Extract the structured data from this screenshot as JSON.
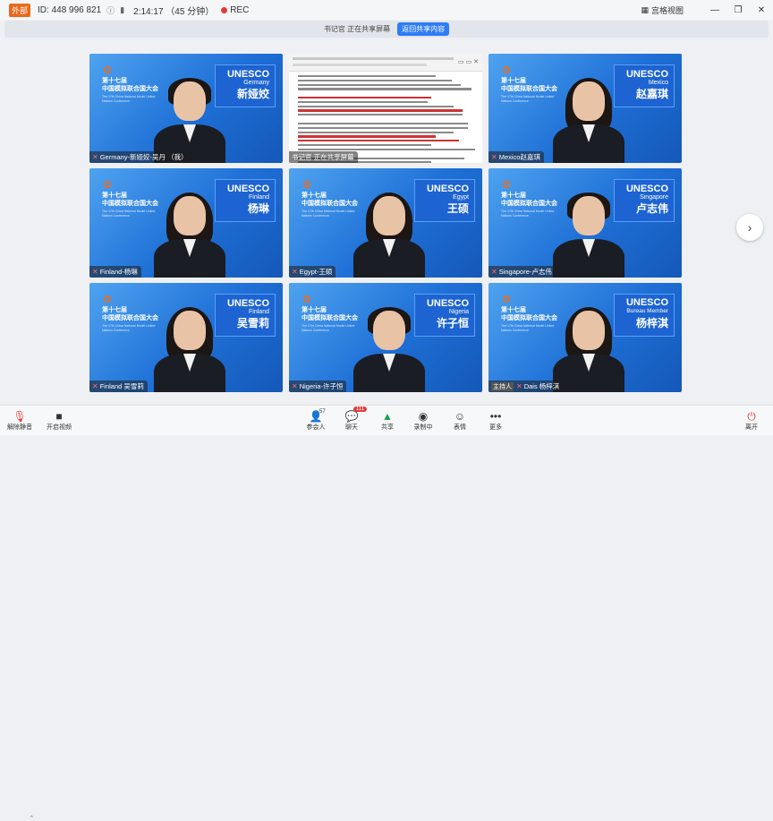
{
  "titlebar": {
    "ext_badge": "外部",
    "meeting_id": "ID: 448 996 821",
    "timer": "2:14:17 （45 分钟）",
    "rec_label": "REC",
    "view_label": "宫格视图",
    "window_controls": [
      "—",
      "❐",
      "✕"
    ]
  },
  "sharebar": {
    "status": "书记官 正在共享屏幕",
    "stop_label": "返回共享内容"
  },
  "conference_bg": {
    "title_line1": "第十七届",
    "title_line2": "中国模拟联合国大会",
    "sub": "The 17th China National Model United Nations Conference"
  },
  "tiles": [
    {
      "org": "UNESCO",
      "country": "Germany",
      "name_cn": "新娅姣",
      "tag": "Germany-新娅姣-吴丹 （我）",
      "hair": "short"
    },
    {
      "type": "share",
      "tag": "书记官 正在共享屏幕"
    },
    {
      "org": "UNESCO",
      "country": "Mexico",
      "name_cn": "赵嘉琪",
      "tag": "Mexico赵嘉琪",
      "hair": "long"
    },
    {
      "org": "UNESCO",
      "country": "Finland",
      "name_cn": "杨琳",
      "tag": "Finland-杨琳",
      "hair": "long"
    },
    {
      "org": "UNESCO",
      "country": "Egypt",
      "name_cn": "王硕",
      "tag": "Egypt-王硕",
      "hair": "long"
    },
    {
      "org": "UNESCO",
      "country": "Singapore",
      "name_cn": "卢志伟",
      "tag": "Singapore-卢志伟",
      "hair": "short"
    },
    {
      "org": "UNESCO",
      "country": "Finland",
      "name_cn": "吴雪莉",
      "tag": "Finland 吴雪莉",
      "hair": "long"
    },
    {
      "org": "UNESCO",
      "country": "Nigeria",
      "name_cn": "许子恒",
      "tag": "Nigeria-许子恒",
      "hair": "short"
    },
    {
      "org": "UNESCO",
      "country": "Bureau Member",
      "name_cn": "杨梓淇",
      "tag": "Dais 杨梓淇",
      "host_label": "主持人",
      "hair": "long"
    }
  ],
  "toolbar": {
    "unmute": "解除静音",
    "video": "开启视频",
    "participants": "参会人",
    "participants_count": "57",
    "chat": "聊天",
    "chat_badge": "111",
    "share": "共享",
    "recording": "录制中",
    "reactions": "表情",
    "more": "更多",
    "leave": "离开"
  },
  "icons": {
    "mic_off": "mic-off-icon",
    "camera": "camera-icon",
    "participants": "participants-icon",
    "chat": "chat-icon",
    "share": "share-screen-icon",
    "record": "record-icon",
    "emoji": "emoji-icon",
    "more": "more-icon",
    "leave": "leave-icon",
    "next": "chevron-right-icon"
  },
  "colors": {
    "rec": "#e23b3b",
    "accent": "#2f7cf6",
    "tile_bg": "#1e6fd6",
    "share_green": "#1aa34a"
  }
}
